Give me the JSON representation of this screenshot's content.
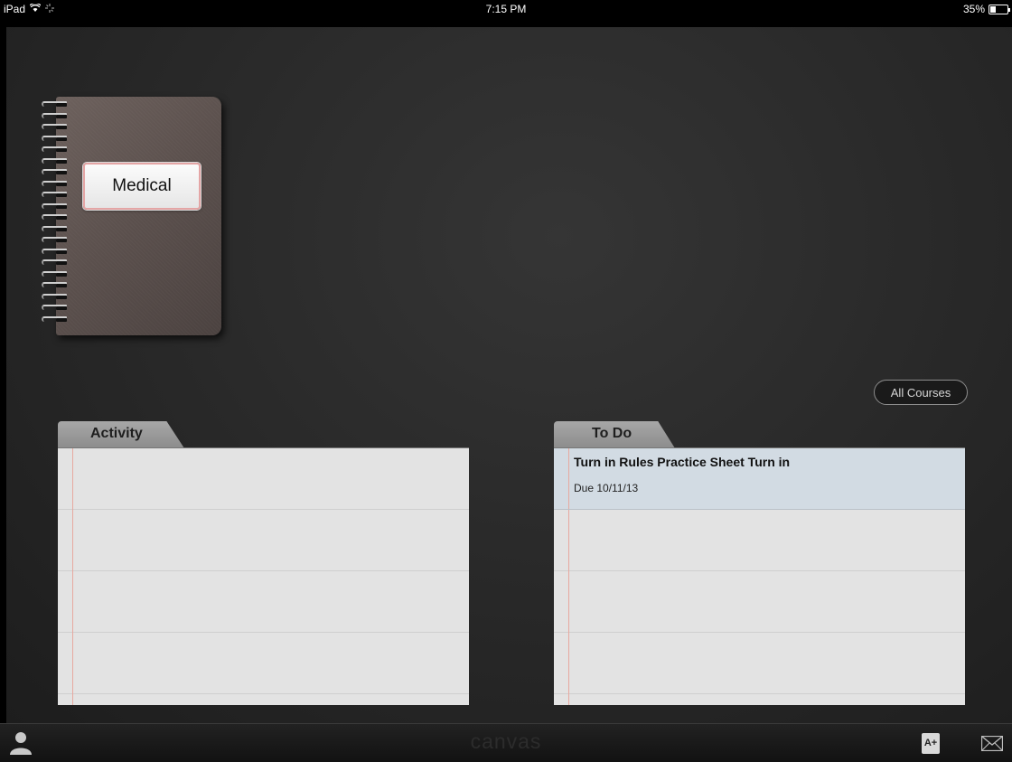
{
  "status_bar": {
    "device": "iPad",
    "time": "7:15 PM",
    "battery_text": "35%",
    "battery_level": 0.35
  },
  "courses": [
    {
      "label": "Medical"
    }
  ],
  "all_courses_label": "All Courses",
  "activity_panel": {
    "title": "Activity",
    "items": []
  },
  "todo_panel": {
    "title": "To Do",
    "items": [
      {
        "title": "Turn in Rules Practice Sheet Turn in",
        "due": "Due 10/11/13"
      }
    ]
  },
  "bottom_bar": {
    "brand": "canvas",
    "icons": [
      "person-icon",
      "grades-icon",
      "mail-icon"
    ],
    "grades_glyph": "A+"
  }
}
